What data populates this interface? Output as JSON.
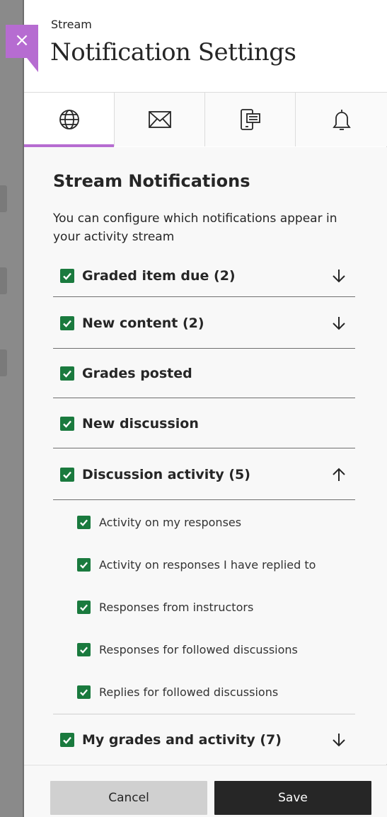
{
  "header": {
    "kicker": "Stream",
    "title": "Notification Settings"
  },
  "close": {
    "label": "×"
  },
  "tabs": [
    {
      "icon": "globe-icon",
      "active": true
    },
    {
      "icon": "envelope-icon",
      "active": false
    },
    {
      "icon": "mobile-push-icon",
      "active": false
    },
    {
      "icon": "bell-icon",
      "active": false
    }
  ],
  "section": {
    "title": "Stream Notifications",
    "description": "You can configure which notifications appear in your activity stream"
  },
  "items": [
    {
      "label": "Graded item due (2)",
      "checked": true,
      "expander": "down"
    },
    {
      "label": "New content (2)",
      "checked": true,
      "expander": "down"
    },
    {
      "label": "Grades posted",
      "checked": true
    },
    {
      "label": "New discussion",
      "checked": true
    },
    {
      "label": "Discussion activity (5)",
      "checked": true,
      "expander": "up"
    },
    {
      "label": "My grades and activity (7)",
      "checked": true,
      "expander": "down"
    }
  ],
  "subitems": [
    {
      "label": "Activity on my responses",
      "checked": true
    },
    {
      "label": "Activity on responses I have replied to",
      "checked": true
    },
    {
      "label": "Responses from instructors",
      "checked": true
    },
    {
      "label": "Responses for followed discussions",
      "checked": true
    },
    {
      "label": "Replies for followed discussions",
      "checked": true
    }
  ],
  "footer": {
    "cancel_label": "Cancel",
    "save_label": "Save"
  },
  "colors": {
    "accent": "#b66cd1",
    "checkbox": "#1a7a3e",
    "primary_button": "#262626"
  }
}
